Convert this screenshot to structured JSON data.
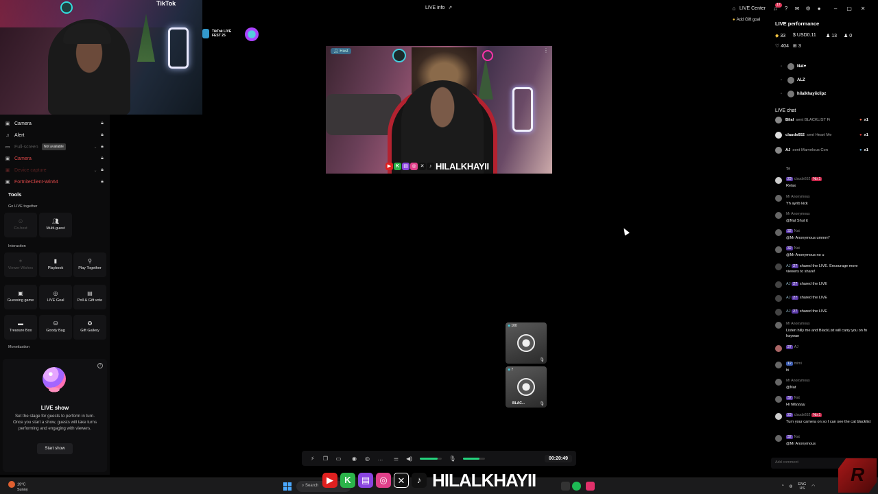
{
  "window": {
    "title": "LIVE info",
    "live_center": "LIVE Center",
    "notif_count": "17",
    "add_gift_goal": "Add Gift goal"
  },
  "webcam": {
    "tag": "TikTok"
  },
  "fest_badge": {
    "text": "TikTok LIVE FEST 25"
  },
  "sources": [
    {
      "label": "Camera",
      "icon": "camera-icon",
      "state": "normal"
    },
    {
      "label": "Alert",
      "icon": "bell-icon",
      "state": "normal"
    },
    {
      "label": "Full-screen",
      "icon": "display-icon",
      "state": "disabled"
    },
    {
      "label": "Camera",
      "icon": "camera-icon",
      "state": "error"
    },
    {
      "label": "Device capture",
      "icon": "capture-icon",
      "state": "disabled"
    },
    {
      "label": "FortniteClient-Win64",
      "icon": "game-icon",
      "state": "error"
    }
  ],
  "tooltip_not_available": "Not available",
  "tools": {
    "title": "Tools",
    "go_live_together": "Go LIVE together",
    "co_host": "Co-host",
    "multi_guest": "Multi-guest",
    "interaction": "Interaction",
    "viewer_wishes": "Viewer Wishes",
    "playbook": "Playbook",
    "play_together": "Play Together",
    "guessing_game": "Guessing game",
    "live_goal": "LIVE Goal",
    "poll_gift_vote": "Poll & Gift vote",
    "treasure_box": "Treasure Box",
    "goody_bag": "Goody Bag",
    "gift_gallery": "Gift Gallery",
    "monetization": "Monetization"
  },
  "live_show": {
    "title": "LIVE show",
    "description": "Set the stage for guests to perform in turn. Once you start a show, guests will take turns performing and engaging with viewers.",
    "button": "Start show"
  },
  "stream": {
    "host_badge": "Host",
    "streamer_name": "HILALKHAYII",
    "guests": [
      {
        "count": "100",
        "name": ""
      },
      {
        "count": "7",
        "name": "BLAC..."
      }
    ],
    "timer": "00:20:49",
    "mic_level": 0.75,
    "speaker_level": 0.8
  },
  "performance": {
    "title": "LIVE performance",
    "diamonds": "33",
    "usd": "USD0.11",
    "viewers": "13",
    "new_followers": "0",
    "likes": "404",
    "gifters": "3",
    "top_viewers": [
      "Nat",
      "ALZ",
      "hilalkhayiiclipz"
    ]
  },
  "chat": {
    "title": "LIVE chat",
    "gifts": [
      {
        "user": "Bilal",
        "text": "sent BLACKLIST Fi",
        "mult": "x1"
      },
      {
        "user": "clauds652",
        "text": "sent Heart Me",
        "mult": "x1"
      },
      {
        "user": "AJ",
        "text": "sent Marvelous Con",
        "mult": "x1"
      }
    ],
    "messages": [
      {
        "level": "",
        "user": "",
        "text": "Tf",
        "no1": ""
      },
      {
        "level": "23",
        "user": "clauds652",
        "text": "Relax",
        "no1": "No.1"
      },
      {
        "level": "",
        "user": "Mr Anonymous",
        "text": "Yh ayrib kick",
        "no1": ""
      },
      {
        "level": "",
        "user": "Mr Anonymous",
        "text": "@Nat Shut it",
        "no1": ""
      },
      {
        "level": "32",
        "user": "Nat",
        "text": "@Mr Anonymous ummm*",
        "no1": ""
      },
      {
        "level": "32",
        "user": "Nat",
        "text": "@Mr Anonymous no u",
        "no1": ""
      }
    ],
    "shares": [
      {
        "user": "AJ",
        "level": "27",
        "text": "shared the LIVE. Encourage more viewers to share!"
      },
      {
        "user": "AJ",
        "level": "27",
        "text": "shared the LIVE"
      },
      {
        "user": "AJ",
        "level": "27",
        "text": "shared the LIVE"
      },
      {
        "user": "AJ",
        "level": "27",
        "text": "shared the LIVE"
      }
    ],
    "messages2": [
      {
        "level": "",
        "user": "Mr Anonymous",
        "text": "Listen hilly me and BlackList will carry you on fn haywan",
        "no1": ""
      },
      {
        "level": "37",
        "user": "AJ",
        "text": "",
        "no1": ""
      },
      {
        "level": "12",
        "user": "mimi",
        "text": "hi",
        "no1": ""
      },
      {
        "level": "",
        "user": "Mr Anonymous",
        "text": "@Nat",
        "no1": ""
      },
      {
        "level": "32",
        "user": "Nat",
        "text": "Hi hillyyyyy",
        "no1": ""
      },
      {
        "level": "23",
        "user": "clauds652",
        "text": "Turn your camera on so I can see the cat blacklist",
        "no1": "No.1"
      },
      {
        "level": "32",
        "user": "Nat",
        "text": "@Mr Anonymous",
        "no1": ""
      }
    ],
    "add_comment": "Add comment"
  },
  "taskbar": {
    "weather_temp": "19°C",
    "weather_desc": "Sunny",
    "search": "Search",
    "lang": "ENG",
    "region": "US"
  },
  "overlay": {
    "name": "HILALKHAYII"
  },
  "colors": {
    "accent_green": "#25d37e",
    "error_red": "#e0494a",
    "badge_red": "#e03a5c"
  }
}
